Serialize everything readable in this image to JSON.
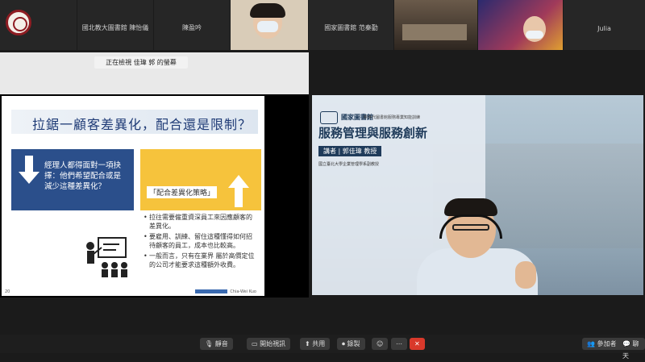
{
  "participants": [
    {
      "name": ""
    },
    {
      "name": "國北教大圖書館 陳怡儀"
    },
    {
      "name": "陳盈吟"
    },
    {
      "name": ""
    },
    {
      "name": "國家圖書館 范秦勤"
    },
    {
      "name": ""
    },
    {
      "name": ""
    },
    {
      "name": "Julia"
    }
  ],
  "share_banner": "正在檢視 佳瑋 郭 的螢幕",
  "slide": {
    "title": "拉鋸一顧客差異化，配合還是限制？",
    "left_box_text": "經理人都得面對一項抉擇：他們希望配合或是減少這種差異化？",
    "right_box_label": "「配合差異化策略」",
    "bullets": [
      "拉往需要僱重資深員工來因應顧客的差異化。",
      "要雇用、訓練、留住這種懂得如何招待顧客的員工，成本也比較高。",
      "一般而言，只有在業界 屬於高價定位的公司才能要求這種額外收費。"
    ],
    "page_number": "20",
    "author": "Chia-Wei Kuo"
  },
  "presenter": {
    "org_name": "國家圖書館",
    "org_subtitle": "新世代圖書館服務專業知能訓練",
    "course_title": "服務管理與服務創新",
    "lecturer": "講者 | 郭佳瑋 教授",
    "affiliation": "國立臺北大學企業管理學系副教授"
  },
  "toolbar": {
    "mute": "靜音",
    "video": "開始視訊",
    "share": "共用",
    "record": "錄製",
    "participants": "參加者",
    "chat": "聊天"
  },
  "colors": {
    "slide_blue": "#2b4f8b",
    "slide_yellow": "#f6c33c",
    "record_red": "#d9392b"
  }
}
